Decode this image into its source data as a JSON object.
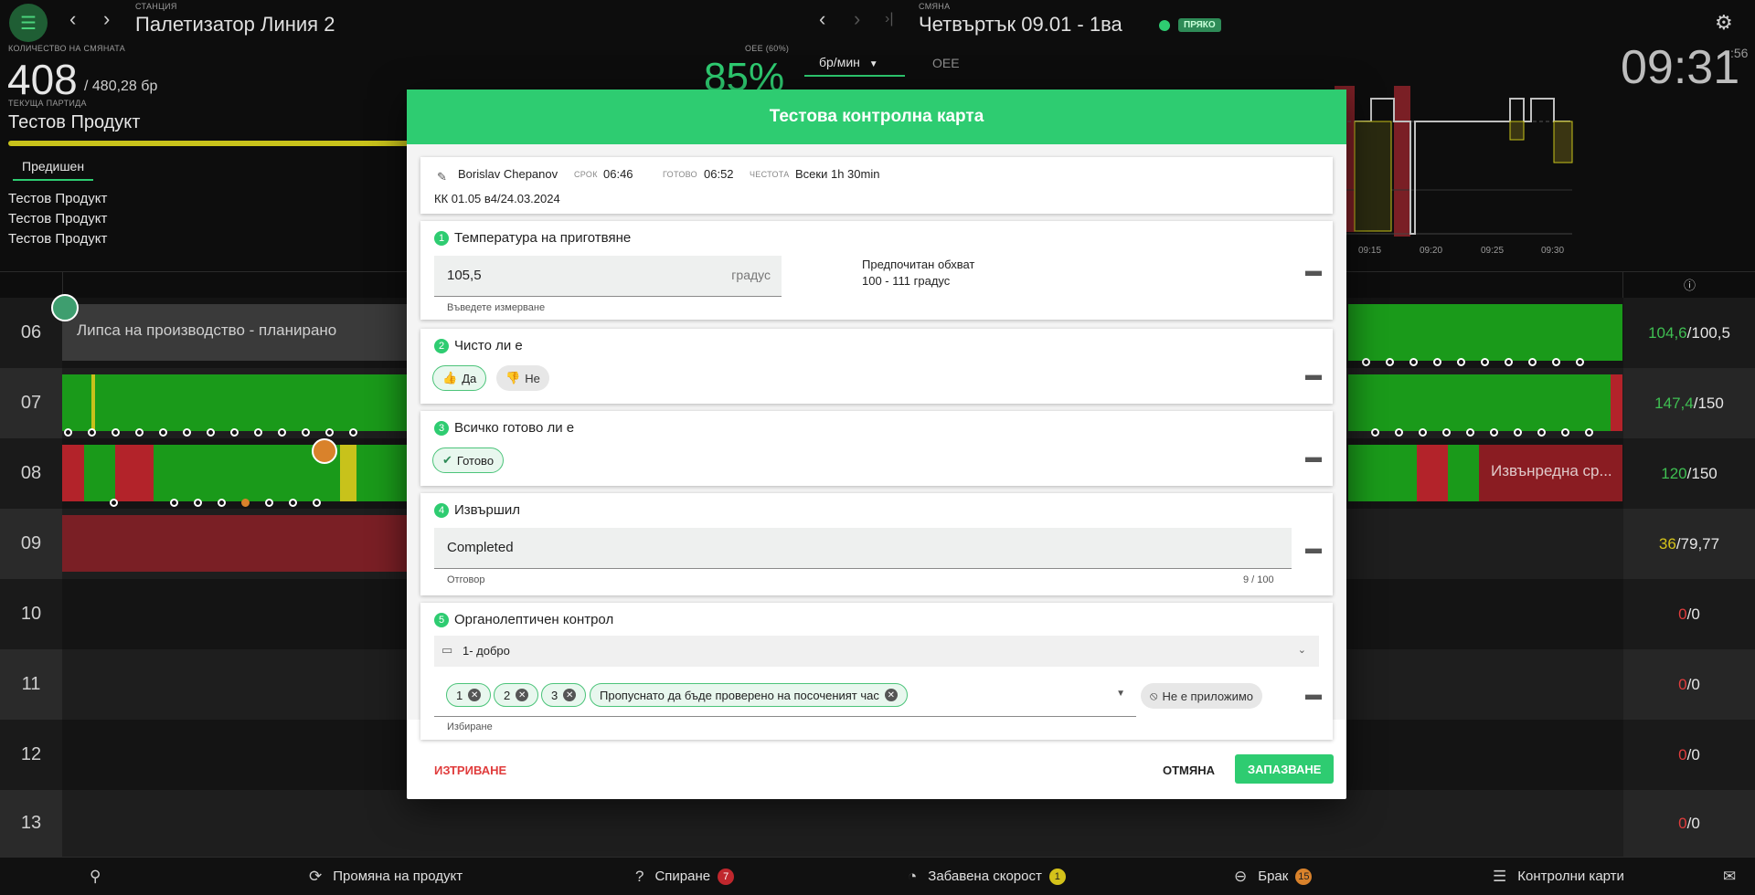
{
  "header": {
    "station_caption": "СТАНЦИЯ",
    "station_title": "Палетизатор Линия 2",
    "shift_caption": "СМЯНА",
    "shift_title": "Четвъртък 09.01 - 1ва",
    "status_badge": "ПРЯКО",
    "clock": "09:31",
    "clock_seconds": ":56"
  },
  "summary": {
    "qty_caption": "КОЛИЧЕСТВО НА СМЯНАТА",
    "qty_value": "408",
    "qty_total": "/ 480,28 бр",
    "batch_caption": "ТЕКУЩА ПАРТИДА",
    "batch_name": "Тестов Продукт",
    "prev_tab": "Предишен",
    "prev_items": [
      "Тестов Продукт",
      "Тестов Продукт",
      "Тестов Продукт"
    ],
    "oee_caption": "OEE (60%)",
    "oee_value": "85%",
    "rate_select": "бр/мин",
    "oee_tab": "OEE"
  },
  "chart_data": {
    "type": "line",
    "x": [
      "09:15",
      "09:20",
      "09:25",
      "09:30"
    ],
    "xlabel": "",
    "ylabel": ""
  },
  "timeline": {
    "rows": [
      {
        "hour": "06",
        "good": "104,6",
        "target": "/100,5",
        "good_color": "#3fbf52",
        "label": "Липса на производство - планирано"
      },
      {
        "hour": "07",
        "good": "147,4",
        "target": "/150",
        "good_color": "#3fbf52"
      },
      {
        "hour": "08",
        "good": "120",
        "target": "/150",
        "good_color": "#3fbf52",
        "label": "Извънредна ср..."
      },
      {
        "hour": "09",
        "good": "36",
        "target": "/79,77",
        "good_color": "#d4c21a"
      },
      {
        "hour": "10",
        "good": "0",
        "target": "/0",
        "good_color": "#e03c3c"
      },
      {
        "hour": "11",
        "good": "0",
        "target": "/0",
        "good_color": "#e03c3c"
      },
      {
        "hour": "12",
        "good": "0",
        "target": "/0",
        "good_color": "#e03c3c"
      },
      {
        "hour": "13",
        "good": "0",
        "target": "/0",
        "good_color": "#e03c3c"
      }
    ]
  },
  "modal": {
    "title": "Тестова контролна карта",
    "meta": {
      "author": "Borislav Chepanov",
      "deadline_label": "СРОК",
      "deadline": "06:46",
      "done_label": "ГОТОВО",
      "done": "06:52",
      "freq_label": "ЧЕСТОТА",
      "freq": "Всеки 1h 30min",
      "code": "КК 01.05 в4/24.03.2024"
    },
    "q1": {
      "num": "1",
      "title": "Температура на приготвяне",
      "value": "105,5",
      "unit": "градус",
      "hint": "Въведете измерване",
      "range_label": "Предпочитан обхват",
      "range": "100 - 111 градус"
    },
    "q2": {
      "num": "2",
      "title": "Чисто ли е",
      "yes": "Да",
      "no": "Не"
    },
    "q3": {
      "num": "3",
      "title": "Всичко готово ли е",
      "done": "Готово"
    },
    "q4": {
      "num": "4",
      "title": "Извършил",
      "value": "Completed",
      "hint": "Отговор",
      "counter": "9 / 100"
    },
    "q5": {
      "num": "5",
      "title": "Органолептичен контрол",
      "select": "1- добро",
      "chips": [
        "1",
        "2",
        "3",
        "Пропуснато да бъде проверено на посоченият час"
      ],
      "na": "Не е приложимо",
      "hint": "Избиране"
    },
    "delete": "ИЗТРИВАНЕ",
    "cancel": "ОТМЯНА",
    "save": "ЗАПАЗВАНЕ"
  },
  "bottom": {
    "change_product": "Промяна на продукт",
    "stop": "Спиране",
    "stop_count": "7",
    "slow": "Забавена скорост",
    "slow_count": "1",
    "scrap": "Брак",
    "scrap_count": "15",
    "checklists": "Контролни карти"
  },
  "colors": {
    "accent": "#2ecc71",
    "danger": "#e03c3c",
    "warning": "#d4c21a"
  }
}
